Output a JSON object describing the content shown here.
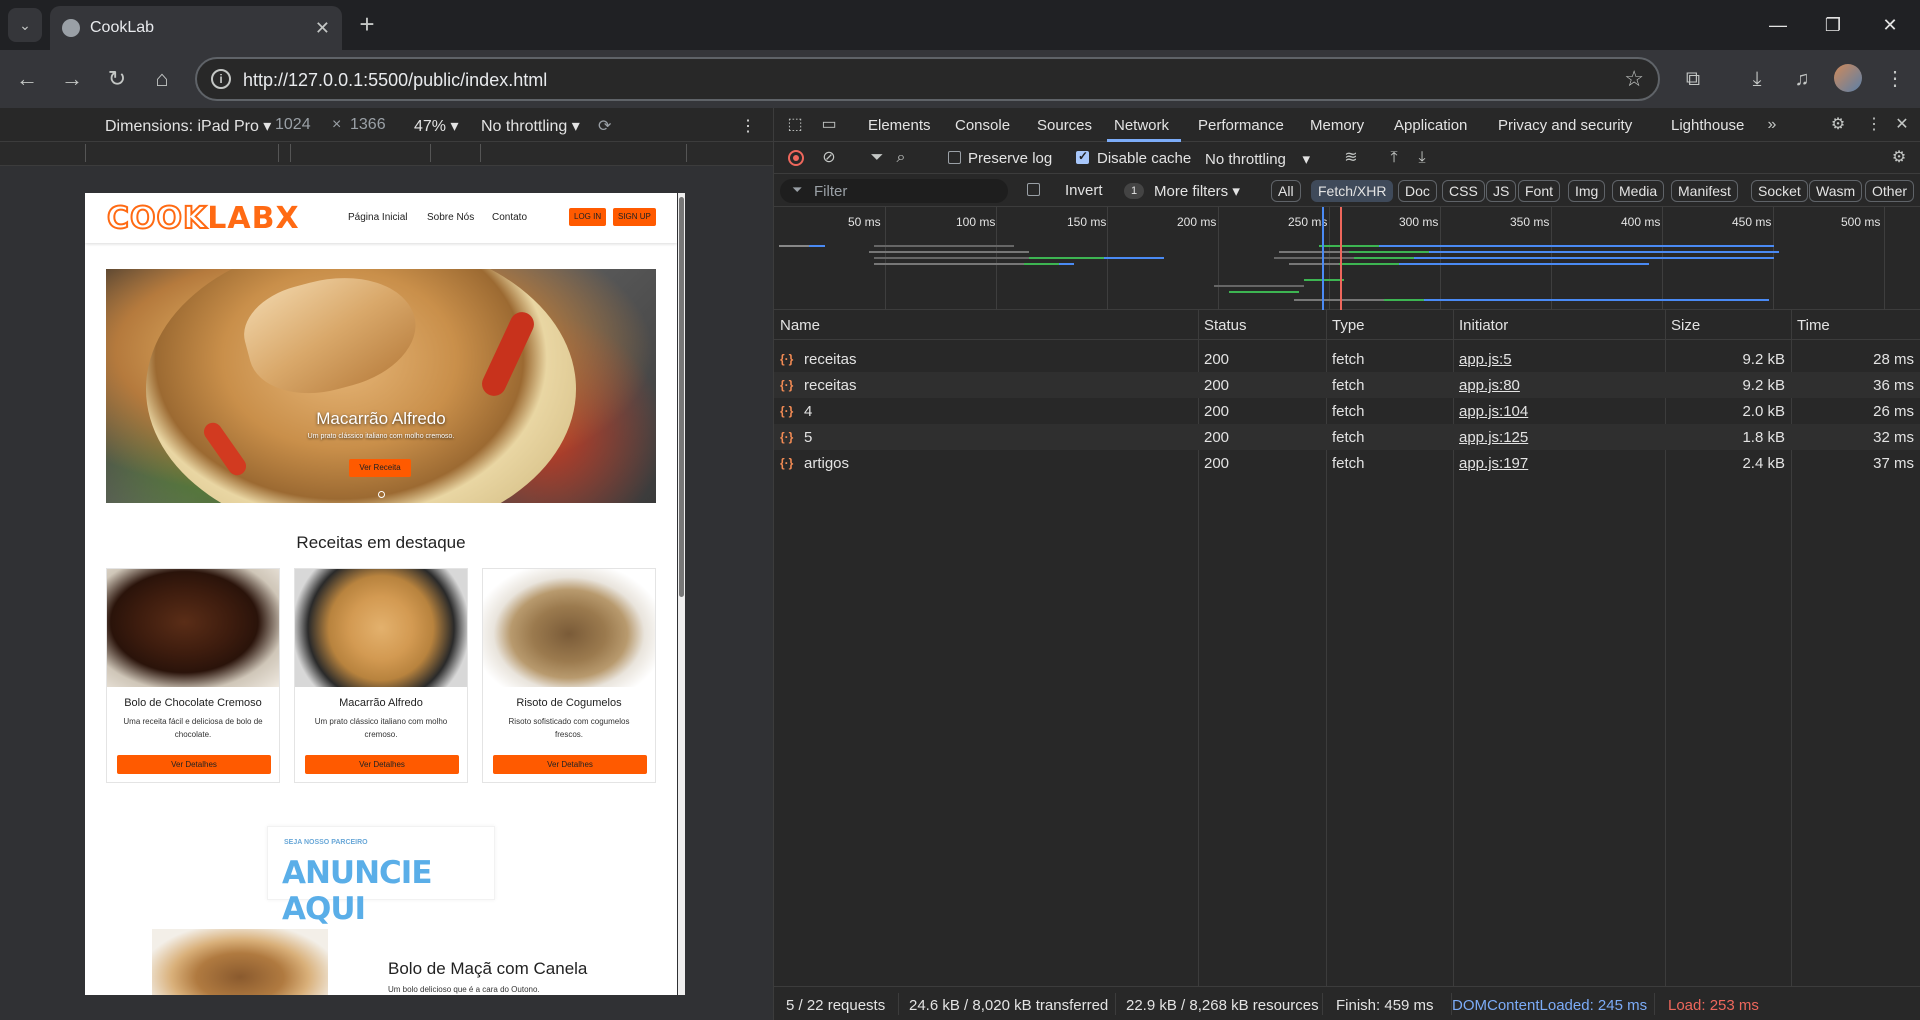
{
  "browser": {
    "tab_title": "CookLab",
    "url": "http://127.0.0.1:5500/public/index.html"
  },
  "device_toolbar": {
    "dimensions_label": "Dimensions: iPad Pro",
    "width": "1024",
    "height": "1366",
    "times": "×",
    "zoom": "47%",
    "throttling": "No throttling"
  },
  "site": {
    "logo_cook": "COOK",
    "logo_lab": "LAB",
    "logo_x": "X",
    "nav": [
      "Página Inicial",
      "Sobre Nós",
      "Contato"
    ],
    "login": "LOG IN",
    "signup": "SIGN UP",
    "hero": {
      "title": "Macarrão Alfredo",
      "subtitle": "Um prato clássico italiano com molho cremoso.",
      "button": "Ver Receita"
    },
    "featured_title": "Receitas em destaque",
    "cards": [
      {
        "name": "Bolo de Chocolate Cremoso",
        "desc": "Uma receita fácil e deliciosa de bolo de chocolate.",
        "button": "Ver Detalhes"
      },
      {
        "name": "Macarrão Alfredo",
        "desc": "Um prato clássico italiano com molho cremoso.",
        "button": "Ver Detalhes"
      },
      {
        "name": "Risoto de Cogumelos",
        "desc": "Risoto sofisticado com cogumelos frescos.",
        "button": "Ver Detalhes"
      }
    ],
    "ad": {
      "small": "SEJA NOSSO PARCEIRO",
      "big": "ANUNCIE AQUI"
    },
    "feature": {
      "title": "Bolo de Maçã com Canela",
      "subtitle": "Um bolo delicioso que é a cara do Outono."
    }
  },
  "devtools": {
    "tabs": [
      "Elements",
      "Console",
      "Sources",
      "Network",
      "Performance",
      "Memory",
      "Application",
      "Privacy and security",
      "Lighthouse"
    ],
    "active_tab": "Network",
    "toolbar": {
      "preserve_log": "Preserve log",
      "disable_cache": "Disable cache",
      "throttling": "No throttling"
    },
    "filter": {
      "placeholder": "Filter",
      "invert": "Invert",
      "more_filters_count": "1",
      "more_filters": "More filters",
      "types": [
        "All",
        "Fetch/XHR",
        "Doc",
        "CSS",
        "JS",
        "Font",
        "Img",
        "Media",
        "Manifest",
        "Socket",
        "Wasm",
        "Other"
      ],
      "selected_type": "Fetch/XHR"
    },
    "overview_ticks": [
      "50 ms",
      "100 ms",
      "150 ms",
      "200 ms",
      "250 ms",
      "300 ms",
      "350 ms",
      "400 ms",
      "450 ms",
      "500 ms"
    ],
    "columns": [
      "Name",
      "Status",
      "Type",
      "Initiator",
      "Size",
      "Time"
    ],
    "requests": [
      {
        "name": "receitas",
        "status": "200",
        "type": "fetch",
        "initiator": "app.js:5",
        "size": "9.2 kB",
        "time": "28 ms"
      },
      {
        "name": "receitas",
        "status": "200",
        "type": "fetch",
        "initiator": "app.js:80",
        "size": "9.2 kB",
        "time": "36 ms"
      },
      {
        "name": "4",
        "status": "200",
        "type": "fetch",
        "initiator": "app.js:104",
        "size": "2.0 kB",
        "time": "26 ms"
      },
      {
        "name": "5",
        "status": "200",
        "type": "fetch",
        "initiator": "app.js:125",
        "size": "1.8 kB",
        "time": "32 ms"
      },
      {
        "name": "artigos",
        "status": "200",
        "type": "fetch",
        "initiator": "app.js:197",
        "size": "2.4 kB",
        "time": "37 ms"
      }
    ],
    "status_bar": {
      "requests": "5 / 22 requests",
      "transferred": "24.6 kB / 8,020 kB transferred",
      "resources": "22.9 kB / 8,268 kB resources",
      "finish": "Finish: 459 ms",
      "dcl": "DOMContentLoaded: 245 ms",
      "load": "Load: 253 ms"
    }
  },
  "colors": {
    "accent": "#ff5a00",
    "devtools_blue": "#7cacf8",
    "devtools_red": "#ee675c"
  }
}
